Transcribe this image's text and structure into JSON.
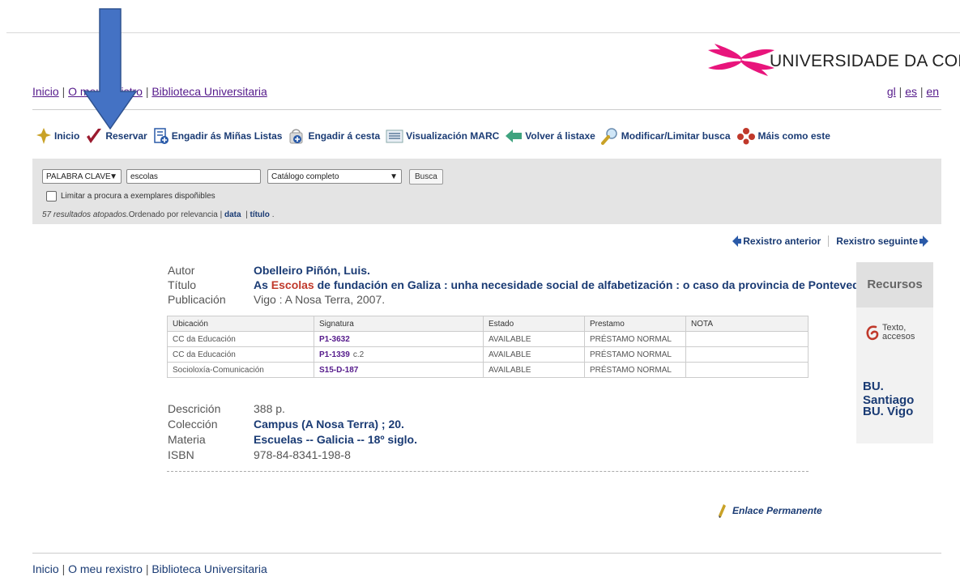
{
  "header": {
    "university_name": "UNIVERSIDADE DA CORUÑA",
    "nav": [
      "Inicio",
      "O meu rexistro",
      "Biblioteca Universitaria"
    ],
    "languages": [
      "gl",
      "es",
      "en"
    ]
  },
  "toolbar": {
    "items": [
      {
        "label": "Inicio",
        "icon": "home-icon"
      },
      {
        "label": "Reservar",
        "icon": "checkmark-icon"
      },
      {
        "label": "Engadir ás Miñas Listas",
        "icon": "list-add-icon"
      },
      {
        "label": "Engadir á cesta",
        "icon": "basket-icon"
      },
      {
        "label": "Visualización MARC",
        "icon": "marc-icon"
      },
      {
        "label": "Volver á listaxe",
        "icon": "back-arrow-icon"
      },
      {
        "label": "Modificar/Limitar busca",
        "icon": "magnifier-icon"
      },
      {
        "label": "Máis como este",
        "icon": "cluster-icon"
      }
    ]
  },
  "search": {
    "field_select": "PALABRA CLAVE",
    "query": "escolas",
    "scope_select": "Catálogo completo",
    "button": "Busca",
    "limit_label": "Limitar a procura a exemplares dispoñibles",
    "results_count": "57 resultados atopados.",
    "sorted_by": "Ordenado por relevancia",
    "sort_date": "data",
    "sort_title": "título"
  },
  "record_nav": {
    "previous": "Rexistro anterior",
    "next": "Rexistro seguinte"
  },
  "record": {
    "author_label": "Autor",
    "author": "Obelleiro Piñón, Luis.",
    "title_label": "Título",
    "title_prefix": "As ",
    "title_highlight": "Escolas",
    "title_rest": " de fundación en Galiza : unha necesidade social de alfabetización : o caso da provincia de Pontevedra",
    "publication_label": "Publicación",
    "publication": "Vigo : A Nosa Terra, 2007.",
    "description_label": "Descrición",
    "description": "388 p.",
    "collection_label": "Colección",
    "collection": "Campus (A Nosa Terra) ;  20.",
    "subject_label": "Materia",
    "subject": "Escuelas -- Galicia -- 18º siglo.",
    "isbn_label": "ISBN",
    "isbn": "978-84-8341-198-8"
  },
  "holdings": {
    "headers": [
      "Ubicación",
      "Signatura",
      "Estado",
      "Prestamo",
      "NOTA"
    ],
    "rows": [
      {
        "location": "CC da Educación",
        "call_number": "P1-3632",
        "copy": "",
        "status": "AVAILABLE",
        "loan": "PRÉSTAMO NORMAL",
        "note": ""
      },
      {
        "location": "CC da Educación",
        "call_number": "P1-1339",
        "copy": "c.2",
        "status": "AVAILABLE",
        "loan": "PRÉSTAMO NORMAL",
        "note": ""
      },
      {
        "location": "Socioloxía-Comunicación",
        "call_number": "S15-D-187",
        "copy": "",
        "status": "AVAILABLE",
        "loan": "PRÉSTAMO NORMAL",
        "note": ""
      }
    ]
  },
  "permalink": "Enlace Permanente",
  "sidebar": {
    "title": "Recursos",
    "eresource_label": "Texto, accesos",
    "links": [
      "BU. Santiago",
      "BU. Vigo"
    ]
  },
  "footer": {
    "nav": [
      "Inicio",
      "O meu rexistro",
      "Biblioteca Universitaria"
    ]
  },
  "colors": {
    "link_blue": "#1a3b74",
    "visited_purple": "#551a8b",
    "highlight_red": "#c0392b",
    "brand_magenta": "#e8157c",
    "annotation_arrow": "#4472c4"
  }
}
